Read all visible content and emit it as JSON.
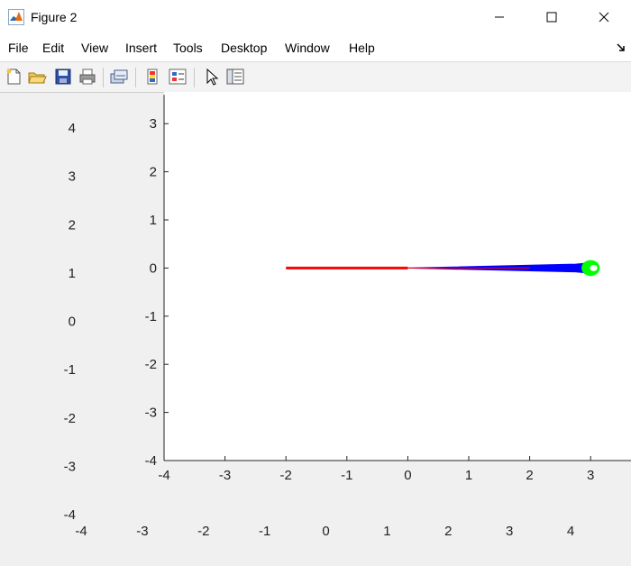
{
  "window": {
    "title": "Figure 2",
    "icon": "matlab-icon",
    "controls": [
      "minimize-icon",
      "maximize-icon",
      "close-icon"
    ]
  },
  "menu": {
    "items": [
      "File",
      "Edit",
      "View",
      "Insert",
      "Tools",
      "Desktop",
      "Window",
      "Help"
    ],
    "dock_icon": "dock-arrow-icon"
  },
  "toolbar": {
    "buttons": [
      "new-figure-icon",
      "open-file-icon",
      "save-icon",
      "print-icon",
      "link-plot-icon",
      "insert-colorbar-icon",
      "insert-legend-icon",
      "edit-plot-icon",
      "property-inspector-icon"
    ]
  },
  "chart_data": [
    {
      "type": "line",
      "title": "",
      "xlabel": "",
      "ylabel": "",
      "xlim": [
        -4,
        3.7
      ],
      "ylim": [
        -4,
        3.6
      ],
      "xticks": [
        -4,
        -3,
        -2,
        -1,
        0,
        1,
        2,
        3
      ],
      "yticks": [
        -4,
        -3,
        -2,
        -1,
        0,
        1,
        2,
        3
      ],
      "grid": false,
      "series": [
        {
          "color": "#ff0000",
          "x": [
            -2,
            0
          ],
          "y": [
            0,
            0
          ]
        },
        {
          "color": "#ff0000",
          "x": [
            0,
            2
          ],
          "y": [
            0,
            0
          ]
        },
        {
          "color": "#0000ff",
          "fill": true,
          "x": [
            0,
            2.75,
            2.92,
            2.95,
            2.92,
            2.75,
            0
          ],
          "y": [
            0,
            0.08,
            0.1,
            0,
            -0.1,
            -0.08,
            0
          ]
        },
        {
          "color": "#00ff00",
          "shape": "circle",
          "center": [
            3,
            0
          ],
          "radius": 0.15
        },
        {
          "color": "#ffffff",
          "shape": "circle",
          "center": [
            3.05,
            0
          ],
          "radius": 0.06
        }
      ]
    },
    {
      "type": "axes-ticks-only",
      "xticks": [
        -4,
        -3,
        -2,
        -1,
        0,
        1,
        2,
        3,
        4
      ],
      "yticks": [
        -4,
        -3,
        -2,
        -1,
        0,
        1,
        2,
        3,
        4
      ],
      "xlim": [
        -4,
        4
      ],
      "ylim": [
        -4,
        4
      ]
    }
  ]
}
